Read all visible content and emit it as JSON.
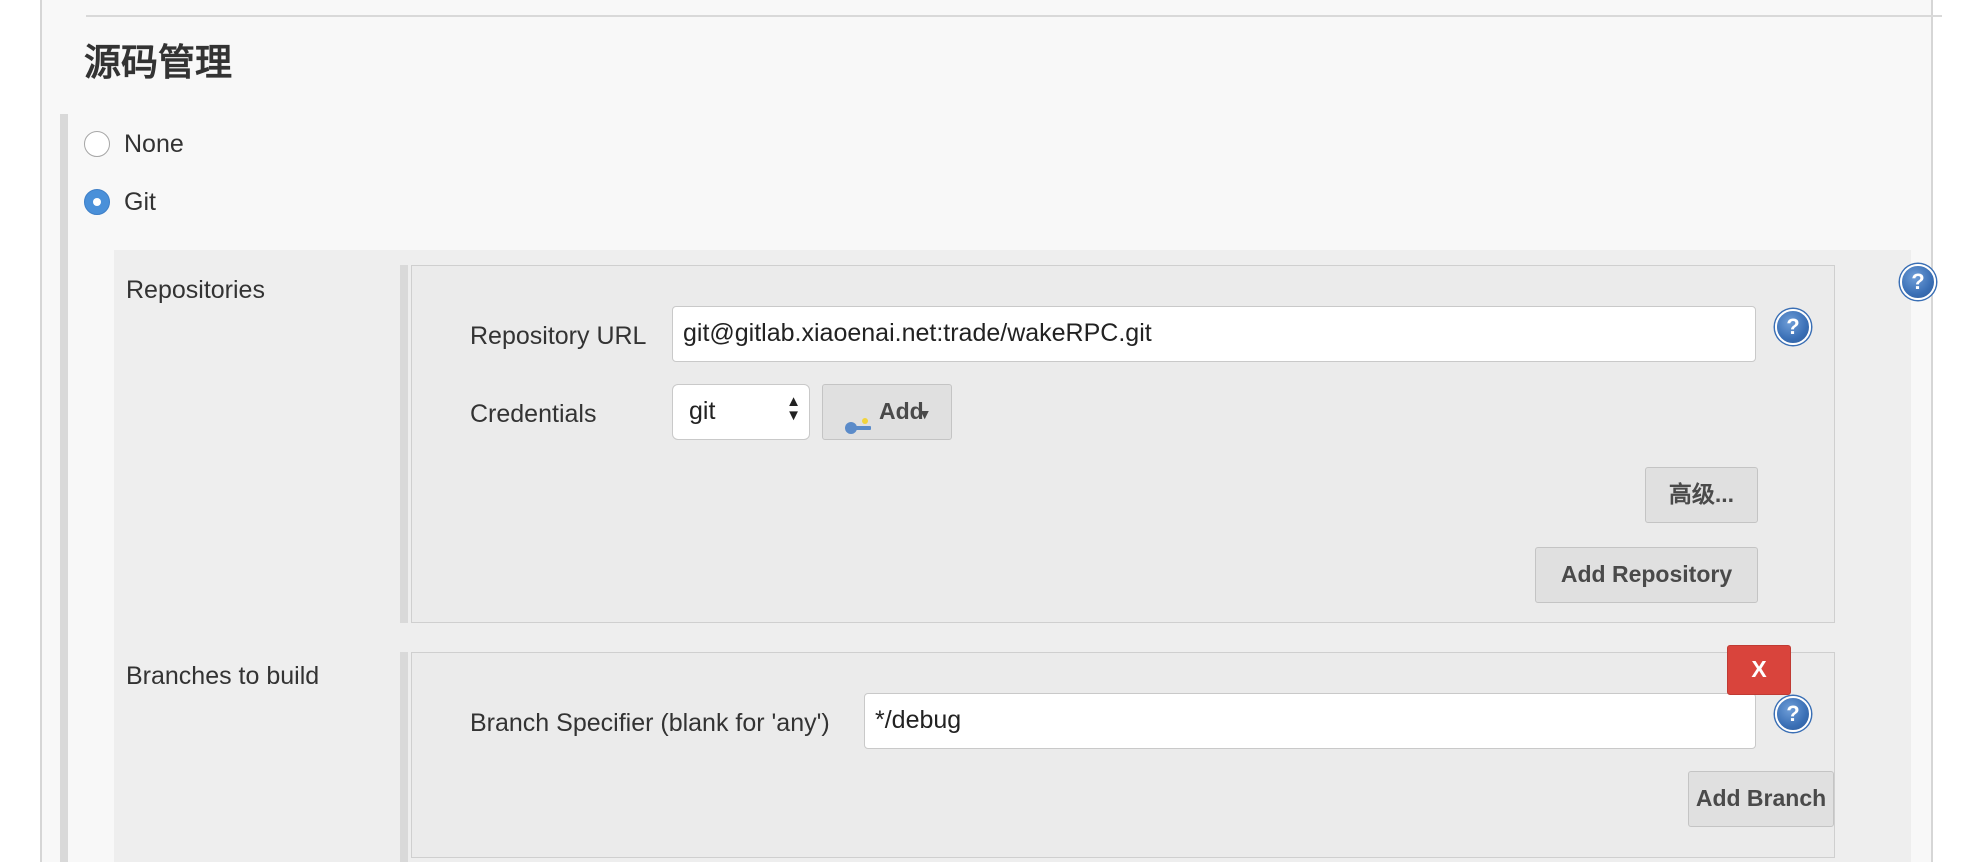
{
  "section": {
    "title": "源码管理"
  },
  "scm_options": [
    {
      "label": "None",
      "checked": false
    },
    {
      "label": "Git",
      "checked": true
    }
  ],
  "repositories": {
    "label": "Repositories",
    "url_label": "Repository URL",
    "url_value": "git@gitlab.xiaoenai.net:trade/wakeRPC.git",
    "credentials_label": "Credentials",
    "credentials_value": "git",
    "add_label": "Add",
    "advanced_label": "高级...",
    "add_repository_label": "Add Repository"
  },
  "branches": {
    "label": "Branches to build",
    "specifier_label": "Branch Specifier (blank for 'any')",
    "specifier_value": "*/debug",
    "delete_label": "X",
    "add_branch_label": "Add Branch"
  },
  "help": {
    "glyph": "?"
  },
  "colors": {
    "help_blue": "#3a6fb5",
    "radio_checked": "#4a90d9",
    "delete_red": "#d9443c"
  }
}
